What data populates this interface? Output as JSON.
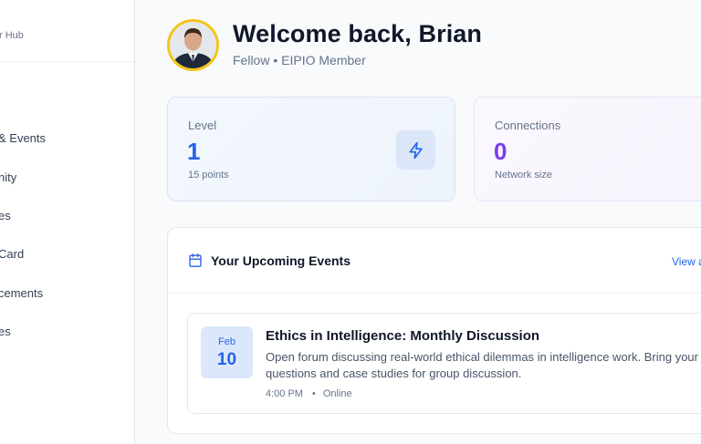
{
  "sidebar": {
    "brand_text": "r Hub",
    "items": [
      {
        "label": "& Events"
      },
      {
        "label": "nity"
      },
      {
        "label": "es"
      },
      {
        "label": "Card"
      },
      {
        "label": "cements"
      },
      {
        "label": "es"
      }
    ]
  },
  "header": {
    "welcome": "Welcome back, Brian",
    "role": "Fellow",
    "separator": "•",
    "organization": "EIPIO Member"
  },
  "stats": {
    "level": {
      "label": "Level",
      "value": "1",
      "sub": "15 points",
      "icon": "lightning-bolt-icon"
    },
    "connections": {
      "label": "Connections",
      "value": "0",
      "sub": "Network size"
    }
  },
  "events": {
    "title": "Your Upcoming Events",
    "view_all": "View a",
    "items": [
      {
        "month": "Feb",
        "day": "10",
        "title": "Ethics in Intelligence: Monthly Discussion",
        "description": "Open forum discussing real-world ethical dilemmas in intelligence work. Bring your questions and case studies for group discussion.",
        "time": "4:00 PM",
        "separator": "•",
        "location": "Online"
      }
    ]
  },
  "colors": {
    "accent_blue": "#2563eb",
    "accent_purple": "#7c3aed",
    "avatar_ring": "#f5c518",
    "title_text": "#0f172a"
  }
}
